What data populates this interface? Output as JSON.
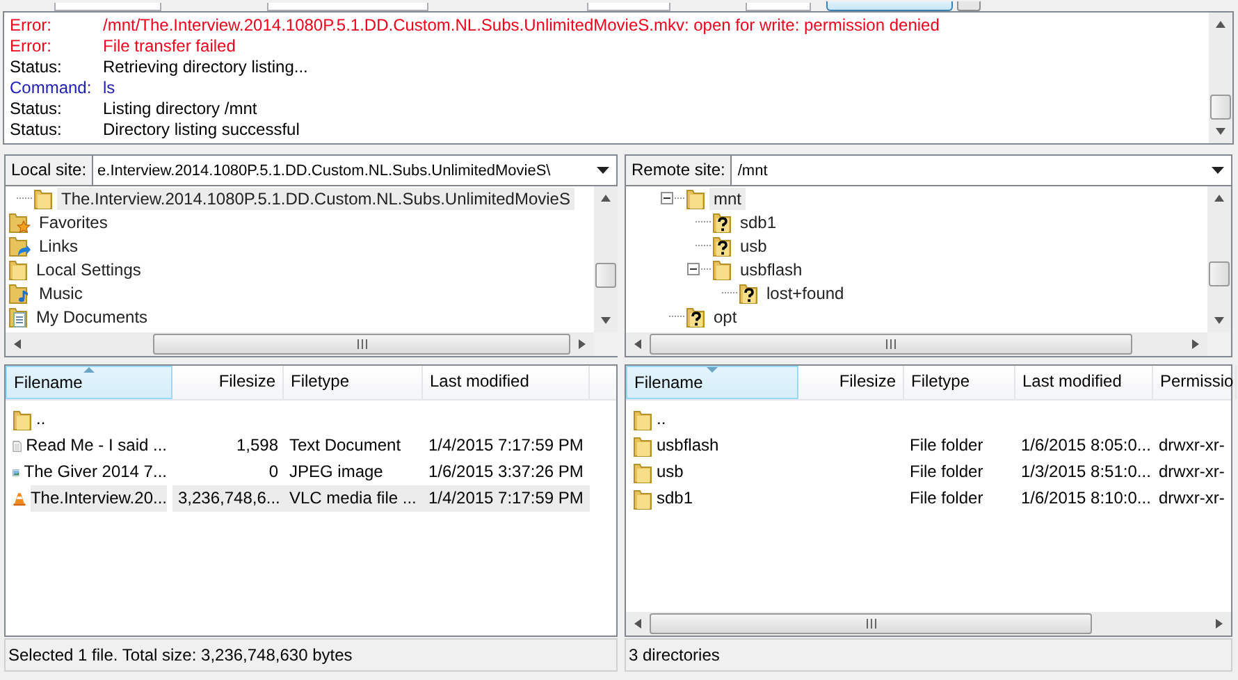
{
  "message_log": [
    {
      "kind": "error",
      "label": "Error:",
      "text": "/mnt/The.Interview.2014.1080P.5.1.DD.Custom.NL.Subs.UnlimitedMovieS.mkv: open for write: permission denied"
    },
    {
      "kind": "error",
      "label": "Error:",
      "text": "File transfer failed"
    },
    {
      "kind": "status",
      "label": "Status:",
      "text": "Retrieving directory listing..."
    },
    {
      "kind": "command",
      "label": "Command:",
      "text": "ls"
    },
    {
      "kind": "status",
      "label": "Status:",
      "text": "Listing directory /mnt"
    },
    {
      "kind": "status",
      "label": "Status:",
      "text": "Directory listing successful"
    }
  ],
  "local": {
    "site_label": "Local site:",
    "path": "e.Interview.2014.1080P.5.1.DD.Custom.NL.Subs.UnlimitedMovieS\\",
    "tree": [
      {
        "label": "The.Interview.2014.1080P.5.1.DD.Custom.NL.Subs.UnlimitedMovieS",
        "kind": "folder",
        "branch": true,
        "selected": true
      },
      {
        "label": "Favorites",
        "kind": "favorites",
        "branch": false,
        "selected": false
      },
      {
        "label": "Links",
        "kind": "links",
        "branch": false,
        "selected": false
      },
      {
        "label": "Local Settings",
        "kind": "folder",
        "branch": false,
        "selected": false
      },
      {
        "label": "Music",
        "kind": "music",
        "branch": false,
        "selected": false
      },
      {
        "label": "My Documents",
        "kind": "documents",
        "branch": false,
        "selected": false
      }
    ],
    "columns": [
      {
        "label": "Filename",
        "kind": "ascending"
      },
      {
        "label": "Filesize",
        "kind": "plain"
      },
      {
        "label": "Filetype",
        "kind": "plain"
      },
      {
        "label": "Last modified",
        "kind": "plain"
      }
    ],
    "rows": [
      {
        "kind": "folder",
        "selected": false,
        "cells": [
          ".."
        ]
      },
      {
        "kind": "text",
        "selected": false,
        "cells": [
          "Read Me - I said ...",
          "1,598",
          "Text Document",
          "1/4/2015 7:17:59 PM"
        ]
      },
      {
        "kind": "image",
        "selected": false,
        "cells": [
          "The Giver 2014 7...",
          "0",
          "JPEG image",
          "1/6/2015 3:37:26 PM"
        ]
      },
      {
        "kind": "video",
        "selected": true,
        "cells": [
          "The.Interview.20...",
          "3,236,748,6...",
          "VLC media file ...",
          "1/4/2015 7:17:59 PM"
        ]
      }
    ],
    "status": "Selected 1 file. Total size: 3,236,748,630 bytes"
  },
  "remote": {
    "site_label": "Remote site:",
    "path": "/mnt",
    "tree": [
      {
        "label": "mnt",
        "kind": "folder",
        "expanded": true,
        "selected": true,
        "children": [
          {
            "label": "sdb1",
            "kind": "unknown",
            "selected": false
          },
          {
            "label": "usb",
            "kind": "unknown",
            "selected": false
          },
          {
            "label": "usbflash",
            "kind": "folder",
            "expanded": true,
            "selected": false,
            "children": [
              {
                "label": "lost+found",
                "kind": "unknown",
                "selected": false
              }
            ]
          }
        ]
      },
      {
        "label": "opt",
        "kind": "unknown",
        "selected": false
      }
    ],
    "columns": [
      {
        "label": "Filename",
        "kind": "descending"
      },
      {
        "label": "Filesize",
        "kind": "plain"
      },
      {
        "label": "Filetype",
        "kind": "plain"
      },
      {
        "label": "Last modified",
        "kind": "plain"
      },
      {
        "label": "Permissio",
        "kind": "plain"
      }
    ],
    "rows": [
      {
        "kind": "folder",
        "selected": false,
        "cells": [
          ".."
        ]
      },
      {
        "kind": "folder",
        "selected": false,
        "cells": [
          "usbflash",
          "",
          "File folder",
          "1/6/2015 8:05:0...",
          "drwxr-xr-"
        ]
      },
      {
        "kind": "folder",
        "selected": false,
        "cells": [
          "usb",
          "",
          "File folder",
          "1/3/2015 8:51:0...",
          "drwxr-xr-"
        ]
      },
      {
        "kind": "folder",
        "selected": false,
        "cells": [
          "sdb1",
          "",
          "File folder",
          "1/6/2015 8:10:0...",
          "drwxr-xr-"
        ]
      }
    ],
    "status": "3 directories"
  }
}
